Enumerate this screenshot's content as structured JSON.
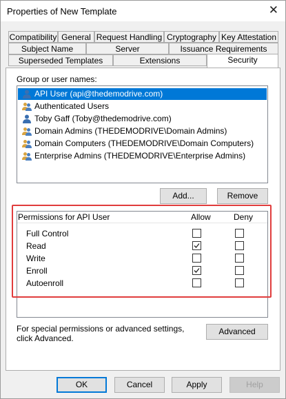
{
  "window": {
    "title": "Properties of New Template"
  },
  "tabs_row1": [
    "Compatibility",
    "General",
    "Request Handling",
    "Cryptography",
    "Key Attestation"
  ],
  "tabs_row2": [
    "Subject Name",
    "Server",
    "Issuance Requirements"
  ],
  "tabs_row3": [
    "Superseded Templates",
    "Extensions",
    "Security"
  ],
  "active_tab": "Security",
  "group_label": "Group or user names:",
  "users": [
    {
      "name": "API User (api@thedemodrive.com)",
      "icon": "user-icon",
      "selected": true
    },
    {
      "name": "Authenticated Users",
      "icon": "users-group-icon",
      "selected": false
    },
    {
      "name": "Toby Gaff (Toby@thedemodrive.com)",
      "icon": "user-icon",
      "selected": false
    },
    {
      "name": "Domain Admins (THEDEMODRIVE\\Domain Admins)",
      "icon": "users-group-icon",
      "selected": false
    },
    {
      "name": "Domain Computers (THEDEMODRIVE\\Domain Computers)",
      "icon": "users-group-icon",
      "selected": false
    },
    {
      "name": "Enterprise Admins (THEDEMODRIVE\\Enterprise Admins)",
      "icon": "users-group-icon",
      "selected": false
    }
  ],
  "buttons": {
    "add": "Add...",
    "remove": "Remove",
    "advanced": "Advanced",
    "ok": "OK",
    "cancel": "Cancel",
    "apply": "Apply",
    "help": "Help"
  },
  "permissions": {
    "header": "Permissions for API User",
    "allow_label": "Allow",
    "deny_label": "Deny",
    "rows": [
      {
        "name": "Full Control",
        "allow": false,
        "deny": false
      },
      {
        "name": "Read",
        "allow": true,
        "deny": false
      },
      {
        "name": "Write",
        "allow": false,
        "deny": false
      },
      {
        "name": "Enroll",
        "allow": true,
        "deny": false
      },
      {
        "name": "Autoenroll",
        "allow": false,
        "deny": false
      }
    ]
  },
  "special_text": "For special permissions or advanced settings, click Advanced.",
  "colors": {
    "selection": "#0078d7",
    "highlight_box": "#e03c3c"
  }
}
